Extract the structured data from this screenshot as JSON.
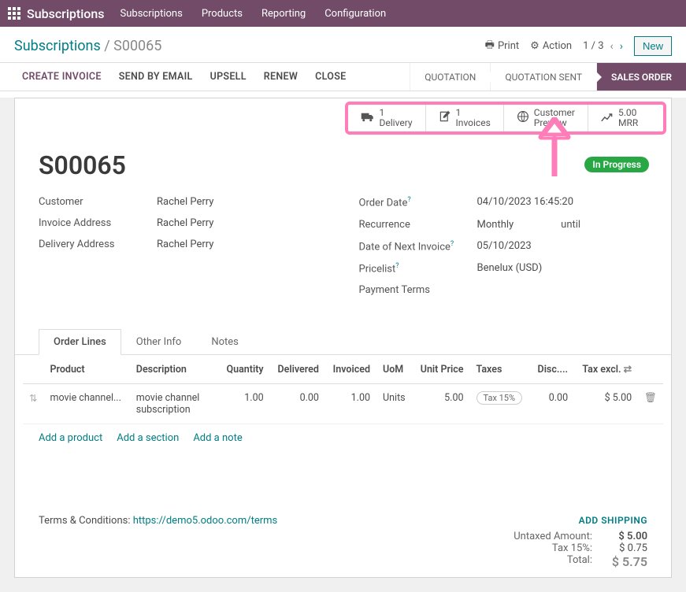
{
  "nav": {
    "app": "Subscriptions",
    "menu": [
      "Subscriptions",
      "Products",
      "Reporting",
      "Configuration"
    ]
  },
  "toolbar": {
    "crumb_root": "Subscriptions",
    "crumb_sep": " / ",
    "crumb_current": "S00065",
    "print": "Print",
    "action": "Action",
    "pager": "1 / 3",
    "new": "New"
  },
  "actions": {
    "create_invoice": "CREATE INVOICE",
    "send_email": "SEND BY EMAIL",
    "upsell": "UPSELL",
    "renew": "RENEW",
    "close": "CLOSE"
  },
  "status": {
    "quotation": "QUOTATION",
    "quotation_sent": "QUOTATION SENT",
    "sales_order": "SALES ORDER"
  },
  "stats": {
    "delivery_n": "1",
    "delivery_l": "Delivery",
    "invoices_n": "1",
    "invoices_l": "Invoices",
    "cust_l1": "Customer",
    "cust_l2": "Preview",
    "mrr_n": "5.00",
    "mrr_l": "MRR"
  },
  "record": {
    "badge": "In Progress",
    "name": "S00065",
    "customer_lbl": "Customer",
    "customer": "Rachel Perry",
    "inv_addr_lbl": "Invoice Address",
    "inv_addr": "Rachel Perry",
    "del_addr_lbl": "Delivery Address",
    "del_addr": "Rachel Perry",
    "order_date_lbl": "Order Date",
    "order_date": "04/10/2023 16:45:20",
    "recur_lbl": "Recurrence",
    "recur": "Monthly",
    "until": "until",
    "next_inv_lbl": "Date of Next Invoice",
    "next_inv": "05/10/2023",
    "pricelist_lbl": "Pricelist",
    "pricelist": "Benelux (USD)",
    "payterm_lbl": "Payment Terms"
  },
  "tabs": {
    "order_lines": "Order Lines",
    "other_info": "Other Info",
    "notes": "Notes"
  },
  "table": {
    "h_product": "Product",
    "h_desc": "Description",
    "h_qty": "Quantity",
    "h_delivered": "Delivered",
    "h_invoiced": "Invoiced",
    "h_uom": "UoM",
    "h_unit": "Unit Price",
    "h_taxes": "Taxes",
    "h_disc": "Disc....",
    "h_taxexcl": "Tax excl.",
    "rows": [
      {
        "product": "movie channel...",
        "desc": "movie channel subscription",
        "qty": "1.00",
        "delivered": "0.00",
        "invoiced": "1.00",
        "uom": "Units",
        "unit": "5.00",
        "tax": "Tax 15%",
        "disc": "0.00",
        "excl": "$ 5.00"
      }
    ]
  },
  "add": {
    "product": "Add a product",
    "section": "Add a section",
    "note": "Add a note"
  },
  "footer": {
    "terms_lbl": "Terms & Conditions: ",
    "terms_url": "https://demo5.odoo.com/terms",
    "add_shipping": "ADD SHIPPING",
    "untaxed_lbl": "Untaxed Amount:",
    "untaxed": "$ 5.00",
    "tax_lbl": "Tax 15%:",
    "tax": "$ 0.75",
    "total_lbl": "Total:",
    "total": "$ 5.75"
  }
}
